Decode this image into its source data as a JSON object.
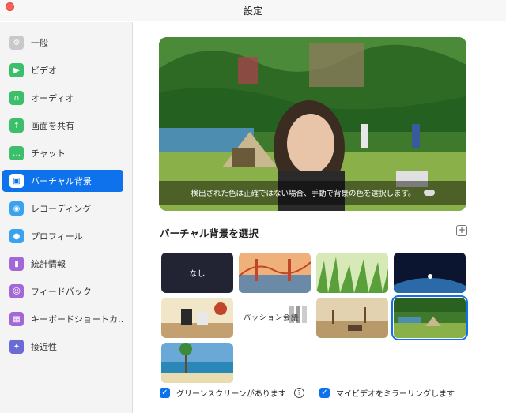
{
  "window": {
    "title": "設定"
  },
  "sidebar": {
    "items": [
      {
        "label": "一般",
        "icon": "gear-icon",
        "color": "#c9c9c9",
        "glyph": "⚙"
      },
      {
        "label": "ビデオ",
        "icon": "video-icon",
        "color": "#3cbf6a",
        "glyph": "▶"
      },
      {
        "label": "オーディオ",
        "icon": "headphones-icon",
        "color": "#3cbf6a",
        "glyph": "∩"
      },
      {
        "label": "画面を共有",
        "icon": "share-screen-icon",
        "color": "#3cbf6a",
        "glyph": "↑"
      },
      {
        "label": "チャット",
        "icon": "chat-icon",
        "color": "#3cbf6a",
        "glyph": "…"
      },
      {
        "label": "バーチャル背景",
        "icon": "virtual-background-icon",
        "color": "#0e72ed",
        "glyph": "▣",
        "active": true
      },
      {
        "label": "レコーディング",
        "icon": "record-icon",
        "color": "#39a3f0",
        "glyph": "◉"
      },
      {
        "label": "プロフィール",
        "icon": "profile-icon",
        "color": "#39a3f0",
        "glyph": "●"
      },
      {
        "label": "統計情報",
        "icon": "statistics-icon",
        "color": "#a367d8",
        "glyph": "▮"
      },
      {
        "label": "フィードバック",
        "icon": "feedback-icon",
        "color": "#a367d8",
        "glyph": "☺"
      },
      {
        "label": "キーボードショートカ…",
        "icon": "keyboard-icon",
        "color": "#a367d8",
        "glyph": "▦"
      },
      {
        "label": "接近性",
        "icon": "accessibility-icon",
        "color": "#6b6bd6",
        "glyph": "✦"
      }
    ]
  },
  "preview": {
    "warning": "検出された色は正確ではない場合、手動で背景の色を選択します。"
  },
  "backgrounds": {
    "section_title": "バーチャル背景を選択",
    "add_icon": "plus-icon",
    "thumbs": [
      {
        "name": "none",
        "label": "なし"
      },
      {
        "name": "golden-gate",
        "label": ""
      },
      {
        "name": "grass",
        "label": ""
      },
      {
        "name": "earth-space",
        "label": ""
      },
      {
        "name": "picnic-table",
        "label": ""
      },
      {
        "name": "pasion-kanji",
        "label": "パッション会議"
      },
      {
        "name": "savanna",
        "label": ""
      },
      {
        "name": "camp-lake",
        "label": "",
        "selected": true
      },
      {
        "name": "beach",
        "label": ""
      }
    ]
  },
  "options": {
    "green_screen": {
      "label": "グリーンスクリーンがあります",
      "checked": true
    },
    "mirror": {
      "label": "マイビデオをミラーリングします",
      "checked": true
    }
  }
}
